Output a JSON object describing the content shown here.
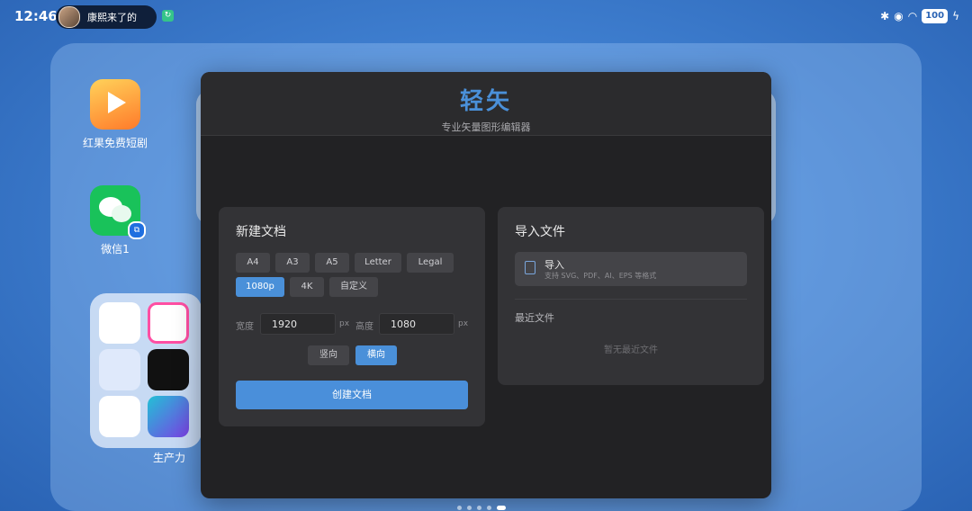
{
  "status": {
    "time": "12:46",
    "live_text": "康熙来了的",
    "battery": "100"
  },
  "desktop": {
    "apps": [
      {
        "label": "红果免费短剧",
        "icon": "hongguo-play-icon"
      },
      {
        "label": "微信1",
        "icon": "wechat-icon"
      }
    ],
    "folder_label": "生产力"
  },
  "window": {
    "app_title": "轻矢",
    "app_subtitle": "专业矢量图形编辑器",
    "new_doc": {
      "title": "新建文档",
      "presets_row1": [
        "A4",
        "A3",
        "A5",
        "Letter",
        "Legal"
      ],
      "presets_row2": [
        "1080p",
        "4K",
        "自定义"
      ],
      "active_preset": "1080p",
      "width_label": "宽度",
      "width_value": "1920",
      "height_label": "高度",
      "height_value": "1080",
      "unit": "px",
      "orientation": [
        "竖向",
        "横向"
      ],
      "active_orientation": "横向",
      "create_label": "创建文档"
    },
    "import": {
      "title": "导入文件",
      "item_label": "导入",
      "item_hint": "支持 SVG、PDF、AI、EPS 等格式",
      "recent_title": "最近文件",
      "recent_empty": "暂无最近文件"
    }
  },
  "colors": {
    "accent": "#4a90d9",
    "window_bg": "#222224",
    "card_bg": "#333336"
  }
}
